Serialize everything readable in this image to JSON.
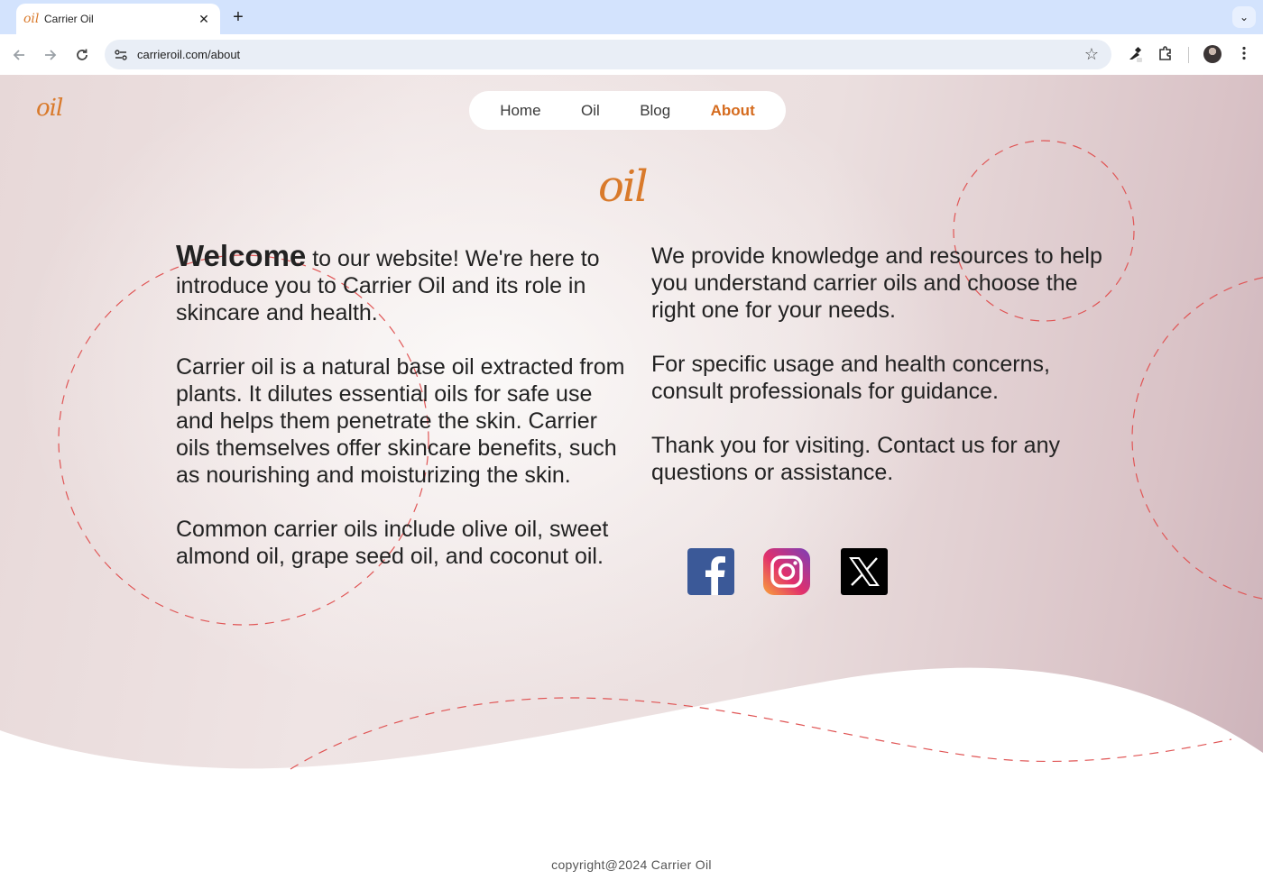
{
  "browser": {
    "tab_title": "Carrier Oil",
    "tab_favicon": "oil",
    "url": "carrieroil.com/about"
  },
  "site": {
    "logo_small": "oil",
    "logo_big": "oil",
    "nav": [
      {
        "label": "Home",
        "active": false
      },
      {
        "label": "Oil",
        "active": false
      },
      {
        "label": "Blog",
        "active": false
      },
      {
        "label": "About",
        "active": true
      }
    ],
    "accent_color": "#d56b1e"
  },
  "content": {
    "left": {
      "welcome": "Welcome",
      "intro_rest": " to our website! We're here to introduce you to Carrier Oil and its role in skincare and health.",
      "p2": "Carrier oil is a natural base oil extracted from plants. It dilutes essential oils for safe use and helps them penetrate the skin. Carrier oils themselves offer skincare benefits, such as nourishing and moisturizing the skin.",
      "p3": "Common carrier oils include olive oil, sweet almond oil, grape seed oil, and coconut oil."
    },
    "right": {
      "p1": "We provide knowledge and resources to help you understand carrier oils and choose the right one for your needs.",
      "p2": "For specific usage and health concerns, consult professionals for guidance.",
      "p3": "Thank you for visiting. Contact us for any questions or assistance."
    }
  },
  "social": [
    {
      "name": "facebook-icon"
    },
    {
      "name": "instagram-icon"
    },
    {
      "name": "x-icon"
    }
  ],
  "footer": {
    "copyright": "copyright@2024 Carrier Oil"
  }
}
